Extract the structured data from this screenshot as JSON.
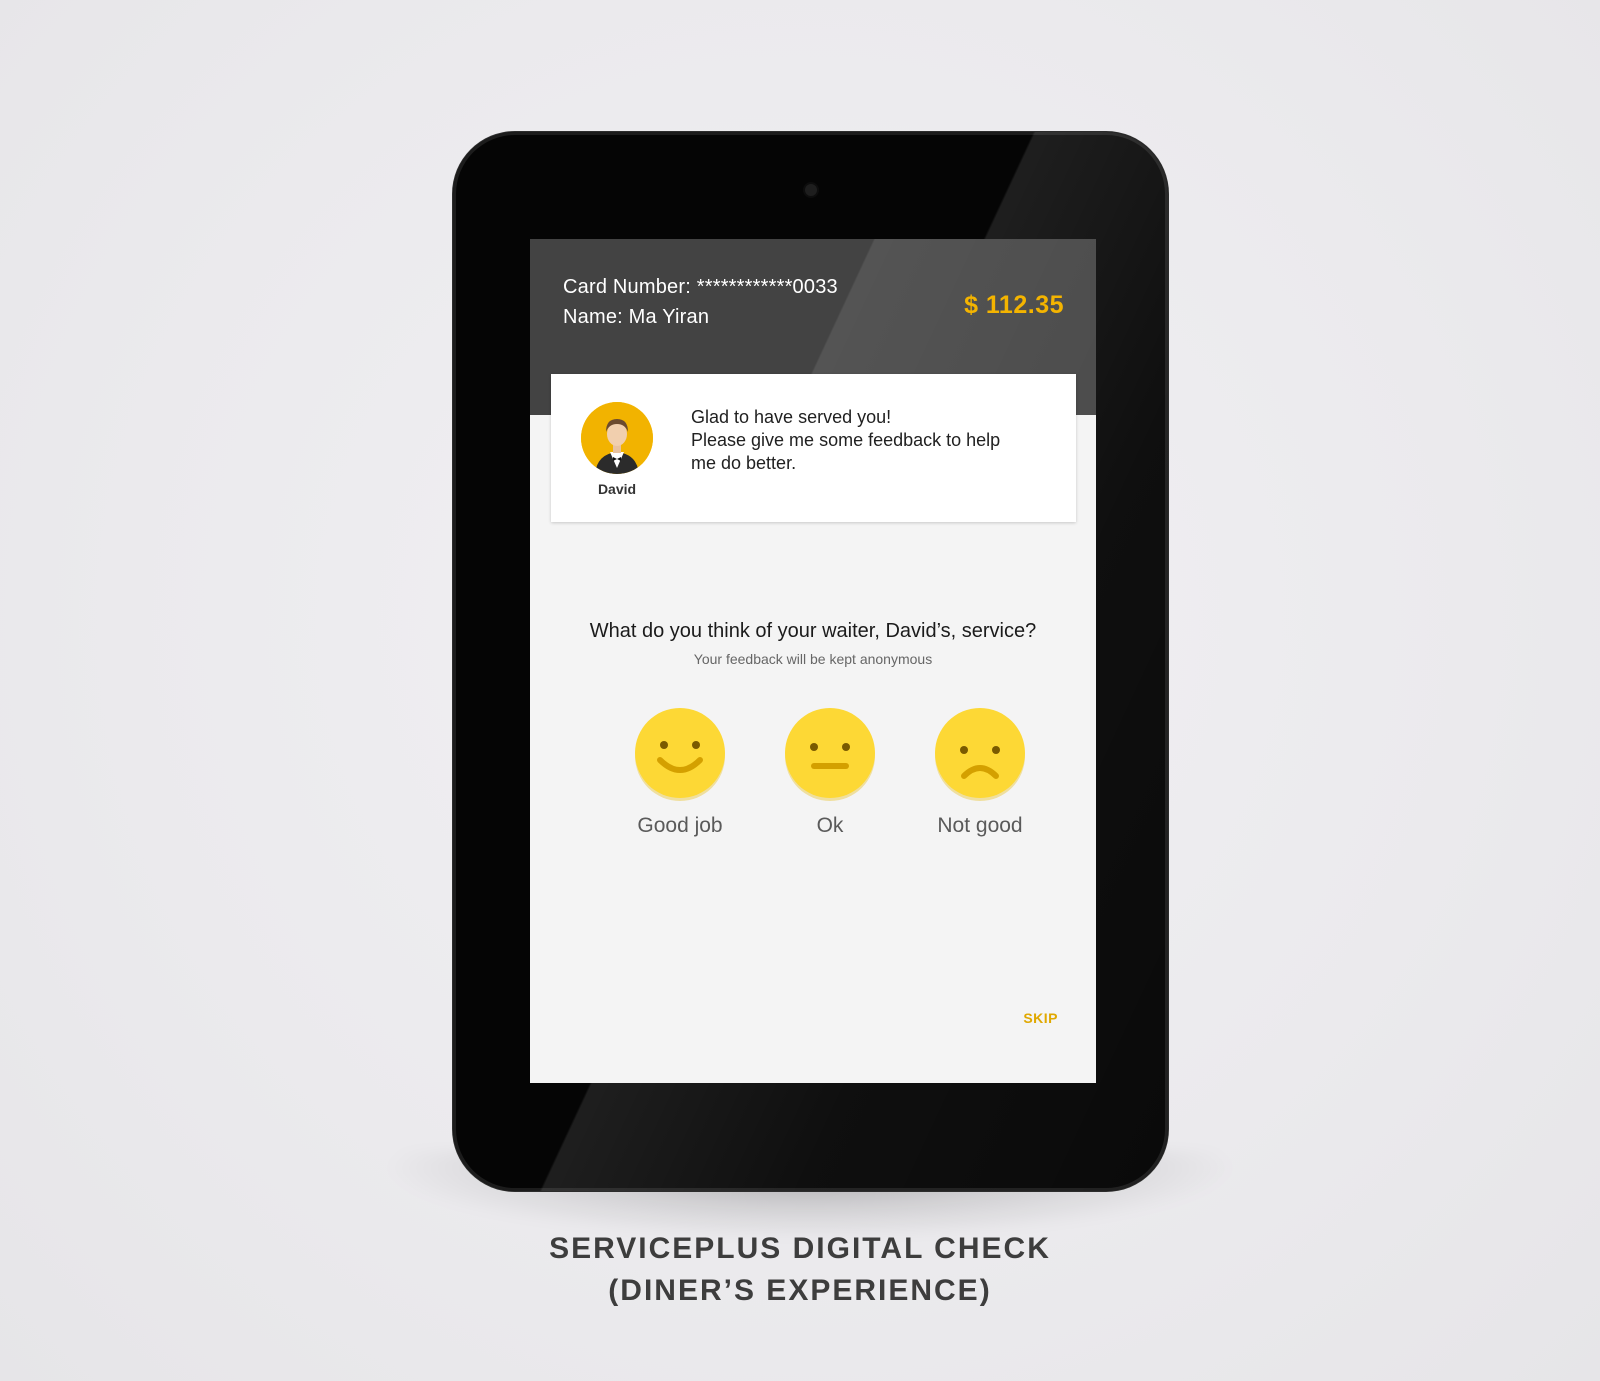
{
  "header": {
    "card_number": "Card Number: ************0033",
    "name": "Name: Ma Yiran",
    "amount": "$ 112.35"
  },
  "waiter": {
    "name": "David",
    "message_lines": [
      "Glad to have served you!",
      "Please give me some feedback to help",
      "me do better."
    ]
  },
  "survey": {
    "question": "What do you think of your waiter, David’s, service?",
    "subtext": "Your feedback will be kept anonymous",
    "options": [
      {
        "label": "Good job",
        "icon": "happy-face-icon"
      },
      {
        "label": "Ok",
        "icon": "neutral-face-icon"
      },
      {
        "label": "Not good",
        "icon": "sad-face-icon"
      }
    ],
    "skip_label": "SKIP"
  },
  "caption": {
    "line1": "SERVICEPLUS DIGITAL CHECK",
    "line2": "(DINER’S EXPERIENCE)"
  },
  "colors": {
    "accent": "#f4b400",
    "face": "#fdd835",
    "header_bg": "#434343"
  }
}
